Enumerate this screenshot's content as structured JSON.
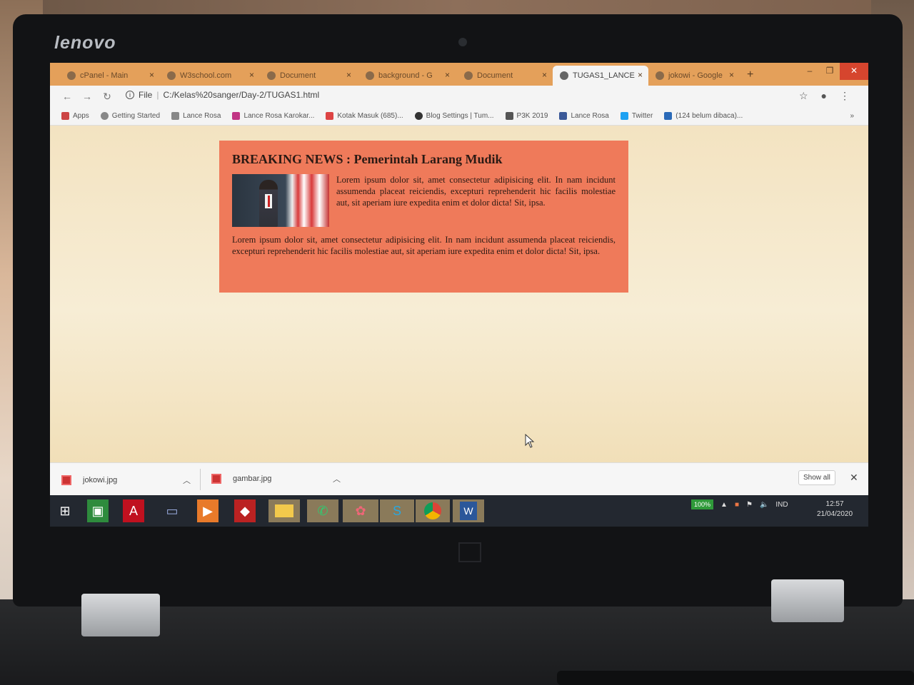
{
  "device": {
    "brand": "lenovo"
  },
  "browser": {
    "tabs": [
      {
        "label": "cPanel - Main"
      },
      {
        "label": "W3school.com"
      },
      {
        "label": "Document"
      },
      {
        "label": "background - G"
      },
      {
        "label": "Document"
      },
      {
        "label": "TUGAS1_LANCE"
      },
      {
        "label": "jokowi - Google"
      }
    ],
    "new_tab": "+",
    "close": "×",
    "address": {
      "scheme": "File",
      "path": "C:/Kelas%20sanger/Day-2/TUGAS1.html"
    },
    "bookmarks": [
      "Apps",
      "Getting Started",
      "Lance Rosa",
      "Lance Rosa Karokar...",
      "Kotak Masuk (685)...",
      "Blog Settings | Tum...",
      "P3K 2019",
      "Lance Rosa",
      "Twitter",
      "(124 belum dibaca)..."
    ],
    "more": "»"
  },
  "article": {
    "headline": "BREAKING NEWS : Pemerintah Larang Mudik",
    "paragraph1": "Lorem ipsum dolor sit, amet consectetur adipisicing elit. In nam incidunt assumenda placeat reiciendis, excepturi reprehenderit hic facilis molestiae aut, sit aperiam iure expedita enim et dolor dicta! Sit, ipsa.",
    "paragraph2": "Lorem ipsum dolor sit, amet consectetur adipisicing elit. In nam incidunt assumenda placeat reiciendis, excepturi reprehenderit hic facilis molestiae aut, sit aperiam iure expedita enim et dolor dicta! Sit, ipsa.",
    "colors": {
      "box": "#ef7a5a",
      "page": "#f4e4c2"
    }
  },
  "downloads": {
    "items": [
      {
        "name": "jokowi.jpg"
      },
      {
        "name": "gambar.jpg"
      }
    ],
    "show_all": "Show all"
  },
  "taskbar": {
    "battery": "100%",
    "language": "IND",
    "time": "12:57",
    "date": "21/04/2020"
  }
}
